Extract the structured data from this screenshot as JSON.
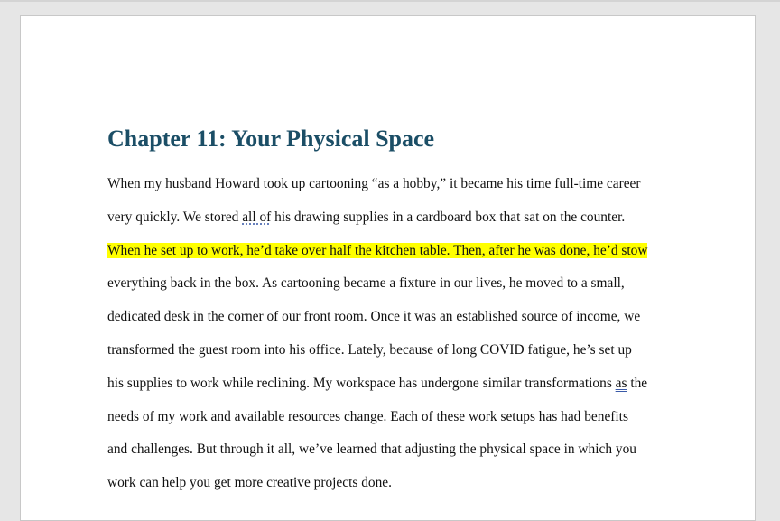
{
  "document": {
    "heading": "Chapter 11: Your Physical Space",
    "lines": [
      [
        "When my husband Howard took up cartooning “as a hobby,” it became his time full-time career"
      ],
      [
        "very quickly. We stored ",
        "all of",
        " his drawing supplies in a cardboard box that sat on the counter."
      ],
      [
        "When he set up to work, he’d take over half the kitchen table. Then, after he was done, he’d stow"
      ],
      [
        "everything back in the box. As cartooning became a fixture in our lives, he moved to a small,"
      ],
      [
        "dedicated desk in the corner of our front room. Once it was an established source of income, we"
      ],
      [
        "transformed the guest room into his office. Lately, because of long COVID fatigue, he’s set up"
      ],
      [
        "his supplies to work while reclining. My workspace has undergone similar transformations ",
        "as",
        " the"
      ],
      [
        "needs of my work and available resources change. Each of these work setups has had benefits"
      ],
      [
        "and challenges. But through it all, we’ve learned that adjusting the physical space in which you"
      ],
      [
        "work can help you get more creative projects done."
      ]
    ]
  },
  "colors": {
    "heading": "#1b4e66",
    "highlight": "#ffff00",
    "text": "#111111"
  }
}
